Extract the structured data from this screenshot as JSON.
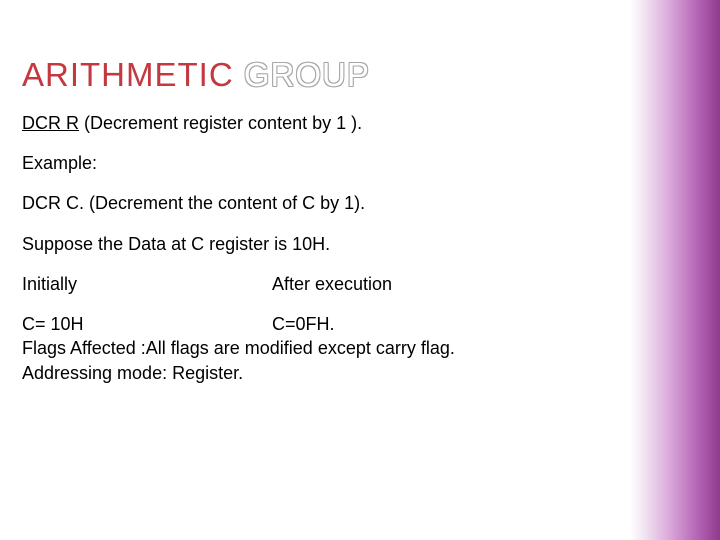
{
  "title": {
    "filled": "ARITHMETIC",
    "outlined": "GROUP"
  },
  "body": {
    "line1_prefix": "DCR R",
    "line1_rest": " (Decrement register content by 1 ).",
    "example_label": "Example:",
    "line2": "DCR C. (Decrement the content of C by 1).",
    "line3": "Suppose the Data at  C register is 10H.",
    "initially_label": "Initially",
    "after_label": "After execution",
    "c_before": " C= 10H",
    "c_after": "C=0FH.",
    "flags": "Flags Affected :All flags are modified except carry flag.",
    "addressing": "Addressing mode: Register."
  }
}
